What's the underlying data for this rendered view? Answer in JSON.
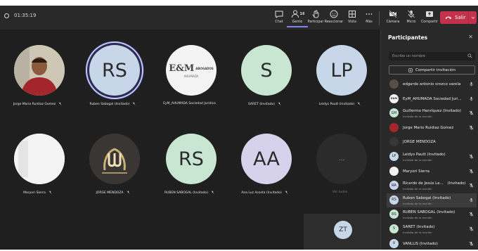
{
  "meeting": {
    "timer": "01:35:19"
  },
  "toolbar": {
    "buttons": [
      {
        "label": "Chat"
      },
      {
        "label": "Gente",
        "count": "16"
      },
      {
        "label": "Participar"
      },
      {
        "label": "Reaccionar"
      },
      {
        "label": "Vista"
      },
      {
        "label": "Más"
      },
      {
        "label": "Cámara"
      },
      {
        "label": "Micro"
      },
      {
        "label": "Compartir"
      }
    ],
    "leave_label": "Salir",
    "leave_color": "#c4314b"
  },
  "tiles": [
    {
      "name": "Jorge Mario Ruidiaz Gomez",
      "initials": "",
      "avatar": "photo-man-red-shirt",
      "muted": true
    },
    {
      "name": "Ruben Sabogal (Invitado)",
      "initials": "RS",
      "avatar": "initials",
      "bg": "#c7d7e9",
      "speaking": true,
      "muted": false
    },
    {
      "name": "EyM_AHUMADA Sociedad Juridica",
      "initials": "",
      "avatar": "logo-eym-ahumada-abogados",
      "logo_text": "E&M",
      "logo_sub": "AHUMADA",
      "logo_right": "ABOGADOS",
      "muted": false
    },
    {
      "name": "SARET (Invitado)",
      "initials": "S",
      "avatar": "initials",
      "bg": "#c8e6d2",
      "muted": true
    },
    {
      "name": "Leidys Pautt (Invitado)",
      "initials": "LP",
      "avatar": "initials",
      "bg": "#c7d7e9",
      "muted": true
    },
    {
      "name": "Maryori Sierra",
      "initials": "",
      "avatar": "photo-white",
      "muted": true
    },
    {
      "name": "JORGE MENDOZA",
      "initials": "",
      "avatar": "logo-gold-emblem",
      "muted": true
    },
    {
      "name": "RUBEN SABOGAL (Invitado)",
      "initials": "RS",
      "avatar": "initials",
      "bg": "#c8e6d2",
      "muted": true
    },
    {
      "name": "Ana Luz Acosta (Invitado)",
      "initials": "AA",
      "avatar": "initials",
      "bg": "#d6d2ec",
      "muted": true
    },
    {
      "name": "Ver todos",
      "initials": "...",
      "avatar": "overflow",
      "muted": false
    }
  ],
  "self_view": {
    "initials": "ZT"
  },
  "panel": {
    "title": "Participantes",
    "search_placeholder": "Escribe un nombre",
    "share_label": "Compartir invitación",
    "participants": [
      {
        "name": "edgardo antonio orozco varela",
        "sub": "",
        "initials": "",
        "av": "photo-dark",
        "mic": "on"
      },
      {
        "name": "EyM_AHUMADA Sociedad Juri...",
        "sub": "",
        "initials": "E&M",
        "av": "logo",
        "mic": "on"
      },
      {
        "name": "Guillermo Henríquez (Invitado)",
        "sub": "Invitado de la reunión",
        "initials": "GH",
        "av": "green",
        "mic": "off"
      },
      {
        "name": "Jorge Mario Ruidiaz Gomez",
        "sub": "",
        "initials": "",
        "av": "photo-red",
        "mic": "off"
      },
      {
        "name": "JORGE MENDOZA",
        "sub": "",
        "initials": "",
        "av": "photo-gold",
        "mic": "none"
      },
      {
        "name": "Leidys Pautt (Invitado)",
        "sub": "Invitado de la reunión",
        "initials": "LP",
        "av": "blue",
        "mic": "off"
      },
      {
        "name": "Maryori Sierra",
        "sub": "",
        "initials": "",
        "av": "white",
        "mic": "off"
      },
      {
        "name": "Ricardo de Jesús La...",
        "name_extra": "(Invitado)",
        "sub": "Invitado de la reunión",
        "initials": "RA",
        "av": "blue",
        "mic": "off"
      },
      {
        "name": "Ruben Sabogal (Invitado)",
        "sub": "Invitado de la reunión",
        "initials": "RS",
        "av": "blue",
        "mic": "on",
        "highlight": true
      },
      {
        "name": "RUBEN SABOGAL (Invitado)",
        "sub": "Invitado de la reunión",
        "initials": "RS",
        "av": "green",
        "mic": "off"
      },
      {
        "name": "SARET (Invitado)",
        "sub": "Invitado de la reunión",
        "initials": "S",
        "av": "green",
        "mic": "off"
      },
      {
        "name": "VANLLIS (Invitado)",
        "sub": "",
        "initials": "V",
        "av": "blue",
        "mic": "off"
      }
    ]
  }
}
